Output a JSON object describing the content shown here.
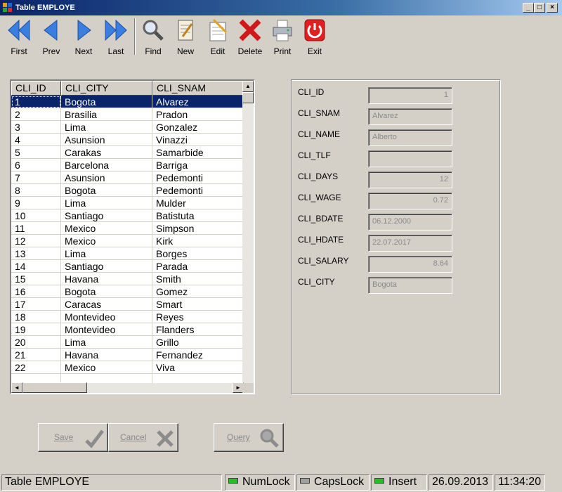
{
  "window": {
    "title": "Table EMPLOYE"
  },
  "toolbar": {
    "first": "First",
    "prev": "Prev",
    "next": "Next",
    "last": "Last",
    "find": "Find",
    "new": "New",
    "edit": "Edit",
    "delete": "Delete",
    "print": "Print",
    "exit": "Exit"
  },
  "grid": {
    "columns": [
      "CLI_ID",
      "CLI_CITY",
      "CLI_SNAM"
    ],
    "rows": [
      [
        "1",
        "Bogota",
        "Alvarez"
      ],
      [
        "2",
        "Brasilia",
        "Pradon"
      ],
      [
        "3",
        "Lima",
        "Gonzalez"
      ],
      [
        "4",
        "Asunsion",
        "Vinazzi"
      ],
      [
        "5",
        "Carakas",
        "Samarbide"
      ],
      [
        "6",
        "Barcelona",
        "Barriga"
      ],
      [
        "7",
        "Asunsion",
        "Pedemonti"
      ],
      [
        "8",
        "Bogota",
        "Pedemonti"
      ],
      [
        "9",
        "Lima",
        "Mulder"
      ],
      [
        "10",
        "Santiago",
        "Batistuta"
      ],
      [
        "11",
        "Mexico",
        "Simpson"
      ],
      [
        "12",
        "Mexico",
        "Kirk"
      ],
      [
        "13",
        "Lima",
        "Borges"
      ],
      [
        "14",
        "Santiago",
        "Parada"
      ],
      [
        "15",
        "Havana",
        "Smith"
      ],
      [
        "16",
        "Bogota",
        "Gomez"
      ],
      [
        "17",
        "Caracas",
        "Smart"
      ],
      [
        "18",
        "Montevideo",
        "Reyes"
      ],
      [
        "19",
        "Montevideo",
        "Flanders"
      ],
      [
        "20",
        "Lima",
        "Grillo"
      ],
      [
        "21",
        "Havana",
        "Fernandez"
      ],
      [
        "22",
        "Mexico",
        "Viva"
      ]
    ]
  },
  "detail": {
    "fields": [
      {
        "label": "CLI_ID",
        "value": "1",
        "num": true
      },
      {
        "label": "CLI_SNAM",
        "value": "Alvarez",
        "num": false
      },
      {
        "label": "CLI_NAME",
        "value": "Alberto",
        "num": false
      },
      {
        "label": "CLI_TLF",
        "value": "",
        "num": false
      },
      {
        "label": "CLI_DAYS",
        "value": "12",
        "num": true
      },
      {
        "label": "CLI_WAGE",
        "value": "0.72",
        "num": true
      },
      {
        "label": "CLI_BDATE",
        "value": "06.12.2000",
        "num": false
      },
      {
        "label": "CLI_HDATE",
        "value": "22.07.2017",
        "num": false
      },
      {
        "label": "CLI_SALARY",
        "value": "8.64",
        "num": true
      },
      {
        "label": "CLI_CITY",
        "value": "Bogota",
        "num": false
      }
    ]
  },
  "buttons": {
    "save": "Save",
    "cancel": "Cancel",
    "query": "Query"
  },
  "status": {
    "table": "Table EMPLOYE",
    "numlock": "NumLock",
    "capslock": "CapsLock",
    "insert": "Insert",
    "date": "26.09.2013",
    "time": "11:34:20"
  },
  "colors": {
    "selection": "#0a246a",
    "led_on": "#22c022",
    "led_off": "#a0a0a0"
  }
}
